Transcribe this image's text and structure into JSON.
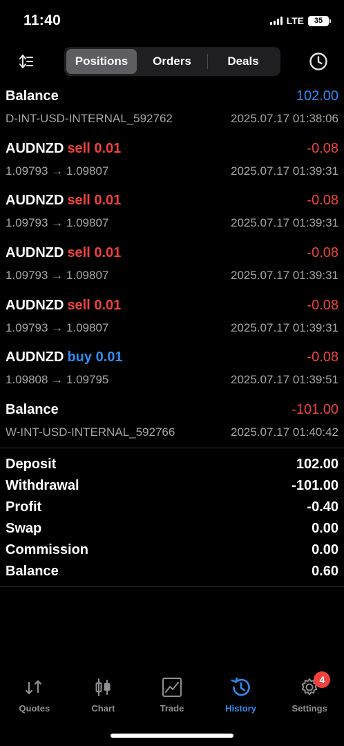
{
  "status_bar": {
    "time": "11:40",
    "network": "LTE",
    "battery": "35"
  },
  "header": {
    "tabs": [
      {
        "label": "Positions",
        "active": true
      },
      {
        "label": "Orders",
        "active": false
      },
      {
        "label": "Deals",
        "active": false
      }
    ],
    "left_icon": "sort-icon",
    "right_icon": "clock-history-icon"
  },
  "rows": [
    {
      "title": "Balance",
      "side": "",
      "volume": "",
      "amount": "102.00",
      "amount_color": "#2f8cf3",
      "detail": "D-INT-USD-INTERNAL_592762",
      "time": "2025.07.17 01:38:06"
    },
    {
      "title": "AUDNZD",
      "side": "sell",
      "volume": "0.01",
      "amount": "-0.08",
      "amount_color": "#f2423d",
      "detail": "1.09793 → 1.09807",
      "time": "2025.07.17 01:39:31"
    },
    {
      "title": "AUDNZD",
      "side": "sell",
      "volume": "0.01",
      "amount": "-0.08",
      "amount_color": "#f2423d",
      "detail": "1.09793 → 1.09807",
      "time": "2025.07.17 01:39:31"
    },
    {
      "title": "AUDNZD",
      "side": "sell",
      "volume": "0.01",
      "amount": "-0.08",
      "amount_color": "#f2423d",
      "detail": "1.09793 → 1.09807",
      "time": "2025.07.17 01:39:31"
    },
    {
      "title": "AUDNZD",
      "side": "sell",
      "volume": "0.01",
      "amount": "-0.08",
      "amount_color": "#f2423d",
      "detail": "1.09793 → 1.09807",
      "time": "2025.07.17 01:39:31"
    },
    {
      "title": "AUDNZD",
      "side": "buy",
      "volume": "0.01",
      "amount": "-0.08",
      "amount_color": "#f2423d",
      "detail": "1.09808 → 1.09795",
      "time": "2025.07.17 01:39:51"
    },
    {
      "title": "Balance",
      "side": "",
      "volume": "",
      "amount": "-101.00",
      "amount_color": "#f2423d",
      "detail": "W-INT-USD-INTERNAL_592766",
      "time": "2025.07.17 01:40:42"
    }
  ],
  "summary": [
    {
      "label": "Deposit",
      "value": "102.00"
    },
    {
      "label": "Withdrawal",
      "value": "-101.00"
    },
    {
      "label": "Profit",
      "value": "-0.40"
    },
    {
      "label": "Swap",
      "value": "0.00"
    },
    {
      "label": "Commission",
      "value": "0.00"
    },
    {
      "label": "Balance",
      "value": "0.60"
    }
  ],
  "tabbar": [
    {
      "label": "Quotes",
      "icon": "quotes-arrows-icon",
      "active": false
    },
    {
      "label": "Chart",
      "icon": "candlestick-chart-icon",
      "active": false
    },
    {
      "label": "Trade",
      "icon": "trade-chart-icon",
      "active": false
    },
    {
      "label": "History",
      "icon": "history-icon",
      "active": true
    },
    {
      "label": "Settings",
      "icon": "gear-icon",
      "active": false,
      "badge": "4"
    }
  ],
  "colors": {
    "sell": "#f2423d",
    "buy": "#2f8cf3",
    "accent": "#2f8cf3"
  }
}
